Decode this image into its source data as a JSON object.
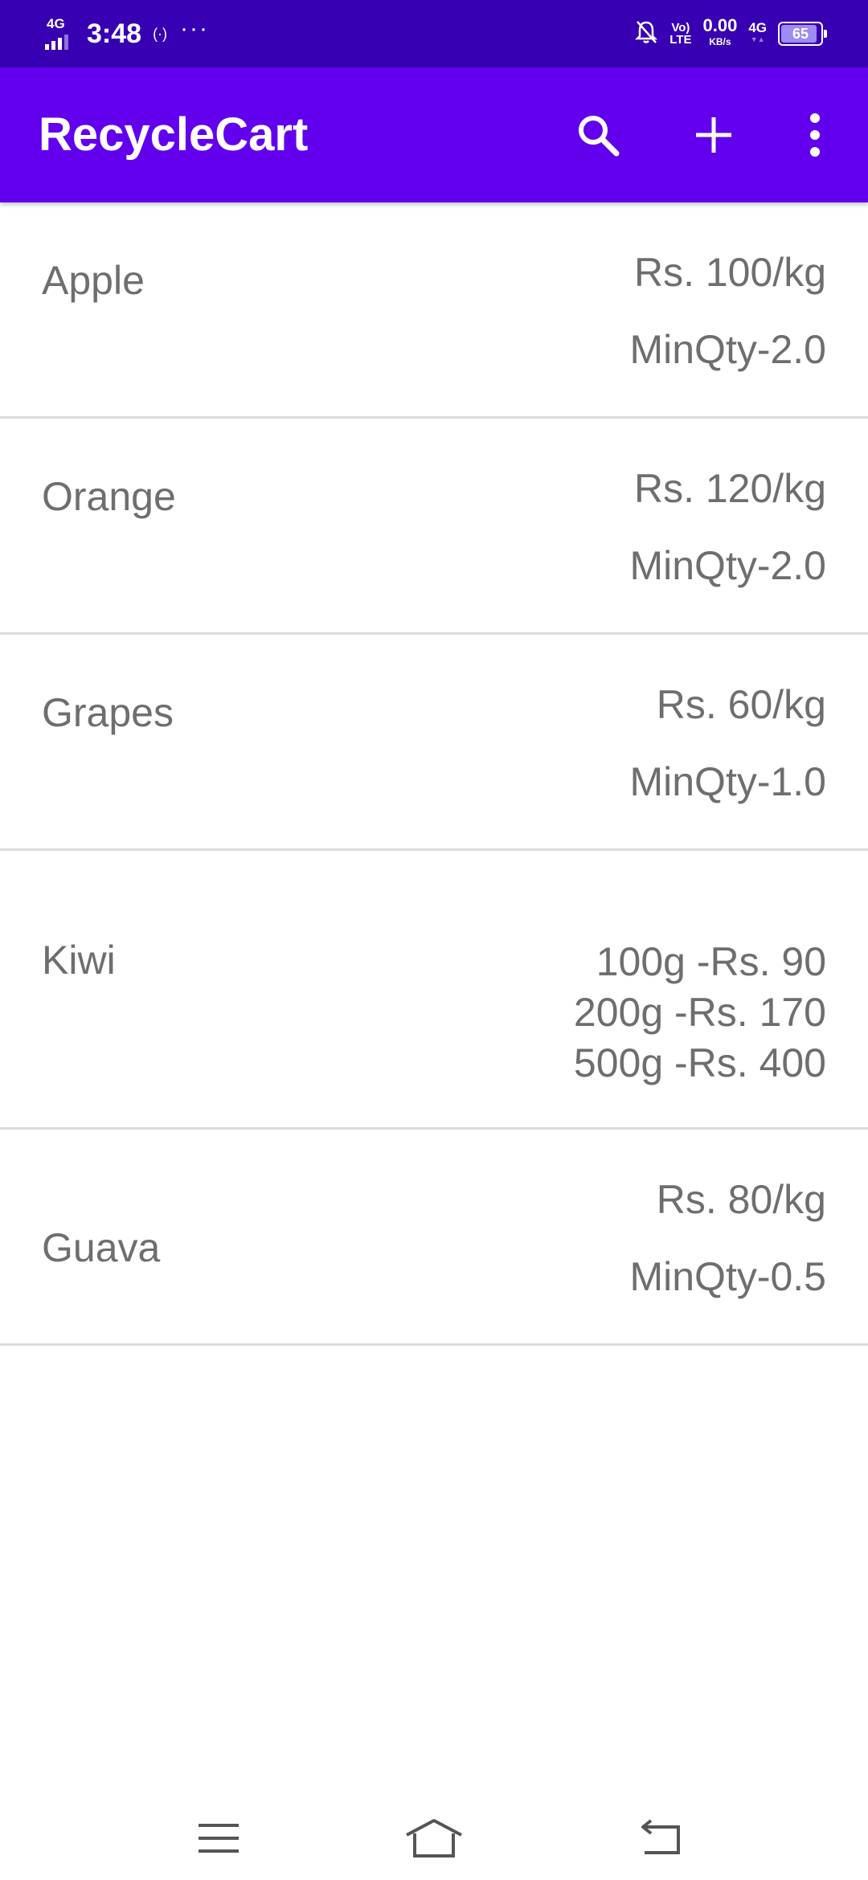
{
  "status_bar": {
    "network": "4G",
    "time": "3:48",
    "hotspot": "(·)",
    "more": "···",
    "volte_top": "Vo)",
    "volte_bottom": "LTE",
    "speed_value": "0.00",
    "speed_unit": "KB/s",
    "network_right": "4G",
    "battery": "65"
  },
  "app_bar": {
    "title": "RecycleCart",
    "icons": [
      "search-icon",
      "add-icon",
      "more-vert-icon"
    ],
    "color": "#6200ee",
    "status_color": "#3700b3"
  },
  "items": [
    {
      "name": "Apple",
      "price": "Rs. 100/kg",
      "min_qty": "MinQty-2.0"
    },
    {
      "name": "Orange",
      "price": "Rs. 120/kg",
      "min_qty": "MinQty-2.0"
    },
    {
      "name": "Grapes",
      "price": "Rs. 60/kg",
      "min_qty": "MinQty-1.0"
    },
    {
      "name": "Kiwi",
      "packs": [
        "100g -Rs. 90",
        "200g -Rs. 170",
        "500g -Rs. 400"
      ]
    },
    {
      "name": "Guava",
      "price": "Rs. 80/kg",
      "min_qty": "MinQty-0.5"
    }
  ],
  "nav_bar": {
    "icons": [
      "menu-icon",
      "home-icon",
      "back-icon"
    ]
  }
}
